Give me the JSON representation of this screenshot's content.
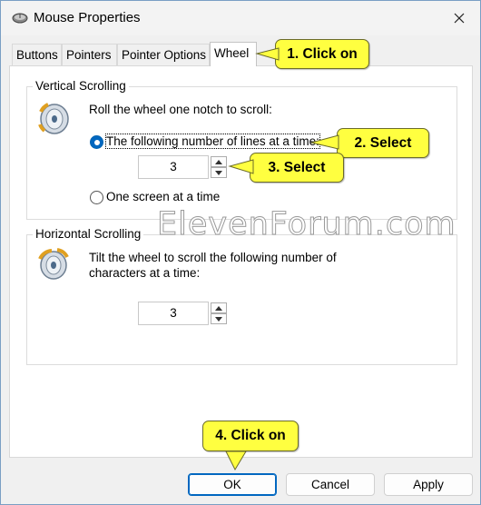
{
  "window": {
    "title": "Mouse Properties",
    "accent_color": "#0067c0"
  },
  "tabs": [
    {
      "label": "Buttons",
      "active": false
    },
    {
      "label": "Pointers",
      "active": false
    },
    {
      "label": "Pointer Options",
      "active": false
    },
    {
      "label": "Wheel",
      "active": true
    }
  ],
  "vertical": {
    "legend": "Vertical Scrolling",
    "description": "Roll the wheel one notch to scroll:",
    "option_lines": "The following number of lines at a time:",
    "option_screen": "One screen at a time",
    "selected_option": "lines",
    "lines_value": "3"
  },
  "horizontal": {
    "legend": "Horizontal Scrolling",
    "description": "Tilt the wheel to scroll the following number of characters at a time:",
    "chars_value": "3"
  },
  "buttons": {
    "ok": "OK",
    "cancel": "Cancel",
    "apply": "Apply"
  },
  "callouts": {
    "step1": "1. Click on",
    "step2": "2. Select",
    "step3": "3. Select",
    "step4": "4. Click on",
    "color": "#ffff40"
  },
  "watermark": "ElevenForum.com"
}
